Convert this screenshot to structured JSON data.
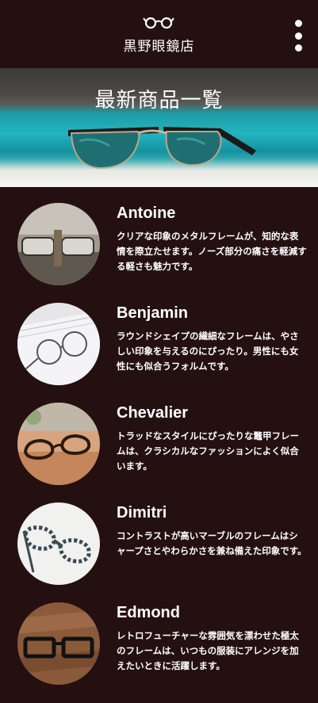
{
  "header": {
    "logo_icon": "glasses-icon",
    "store_name": "黒野眼鏡店",
    "menu_icon": "vertical-dots-icon"
  },
  "hero": {
    "title": "最新商品一覧"
  },
  "products": [
    {
      "name": "Antoine",
      "description": "クリアな印象のメタルフレームが、知的な表情を際立たせます。ノーズ部分の痛さを軽減する軽さも魅力です。"
    },
    {
      "name": "Benjamin",
      "description": "ラウンドシェイプの繊細なフレームは、やさしい印象を与えるのにぴったり。男性にも女性にも似合うフォルムです。"
    },
    {
      "name": "Chevalier",
      "description": "トラッドなスタイルにぴったりな鼈甲フレームは、クラシカルなファッションによく似合います。"
    },
    {
      "name": "Dimitri",
      "description": "コントラストが高いマーブルのフレームはシャープさとやわらかさを兼ね備えた印象です。"
    },
    {
      "name": "Edmond",
      "description": "レトロフューチャーな雰囲気を漂わせた極太のフレームは、いつもの服装にアレンジを加えたいときに活躍します。"
    }
  ]
}
